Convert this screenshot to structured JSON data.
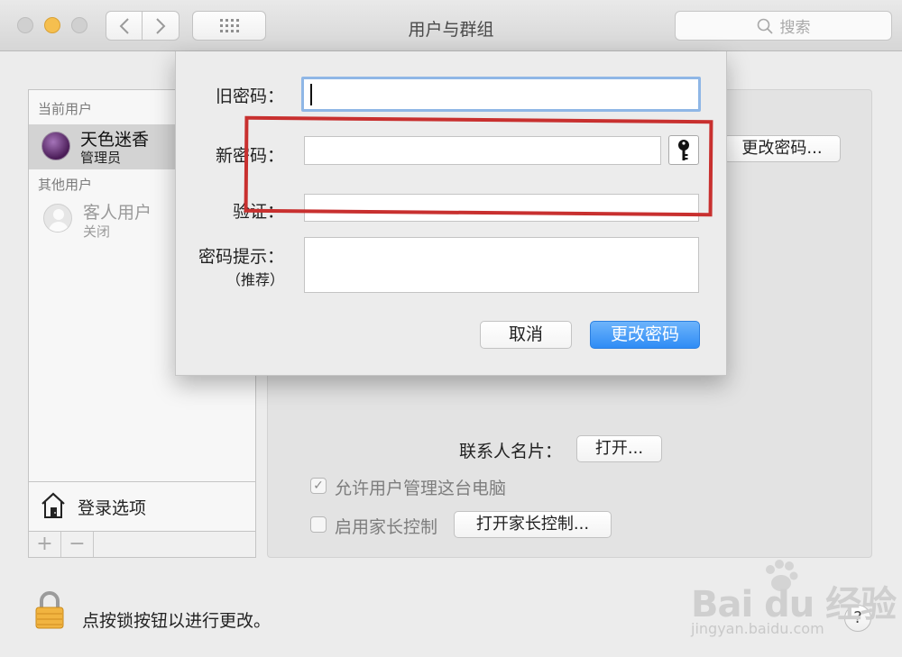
{
  "window": {
    "title": "用户与群组",
    "search_placeholder": "搜索"
  },
  "sidebar": {
    "current_users_header": "当前用户",
    "current_user": {
      "name": "天色迷香",
      "role": "管理员"
    },
    "other_users_header": "其他用户",
    "guest_user": {
      "name": "客人用户",
      "status": "关闭"
    },
    "login_options_label": "登录选项",
    "add_label": "+",
    "remove_label": "−"
  },
  "pane": {
    "change_password_button": "更改密码...",
    "contact_card_label": "联系人名片：",
    "open_button": "打开...",
    "allow_admin_label": "允许用户管理这台电脑",
    "allow_admin_checked": true,
    "parental_controls_label": "启用家长控制",
    "parental_controls_checked": false,
    "open_parental_controls_button": "打开家长控制..."
  },
  "sheet": {
    "old_password_label": "旧密码：",
    "old_password_value": "",
    "new_password_label": "新密码：",
    "new_password_value": "",
    "verify_label": "验证：",
    "verify_value": "",
    "hint_label": "密码提示：",
    "hint_sub_label": "（推荐）",
    "hint_value": "",
    "cancel_button": "取消",
    "confirm_button": "更改密码"
  },
  "footer": {
    "lock_text": "点按锁按钮以进行更改。",
    "help_label": "?"
  },
  "watermark": {
    "logo_text": "Bai du 经验",
    "url": "jingyan.baidu.com"
  },
  "colors": {
    "accent_blue": "#3a91f5",
    "highlight_red": "#c8302f",
    "minimize_yellow": "#f5bf4f"
  }
}
